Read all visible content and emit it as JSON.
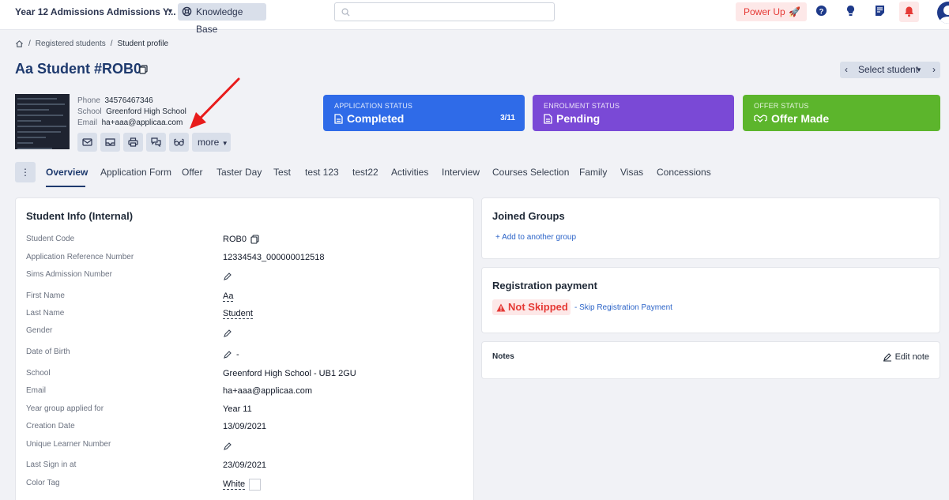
{
  "topbar": {
    "title": "Year 12 Admissions Admissions Y...",
    "knowledge_base": "Knowledge Base",
    "power_up": "Power Up",
    "icons": [
      "help-icon",
      "lightbulb-icon",
      "notes-icon",
      "bell-icon",
      "user-avatar"
    ]
  },
  "breadcrumb": {
    "items": [
      "Registered students",
      "Student profile"
    ]
  },
  "profile": {
    "title": "Aa Student #ROB0",
    "select_student": "Select student",
    "phone_label": "Phone",
    "phone": "34576467346",
    "school_label": "School",
    "school": "Greenford High School",
    "email_label": "Email",
    "email": "ha+aaa@applicaa.com",
    "more_label": "more",
    "action_icons": [
      "mail-icon",
      "inbox-icon",
      "print-icon",
      "chat-icon",
      "glasses-icon"
    ]
  },
  "status_cards": [
    {
      "label": "APPLICATION STATUS",
      "value": "Completed",
      "count": "3/11",
      "color": "#2f6be8"
    },
    {
      "label": "ENROLMENT STATUS",
      "value": "Pending",
      "count": "",
      "color": "#7a49d6"
    },
    {
      "label": "OFFER STATUS",
      "value": "Offer Made",
      "count": "",
      "color": "#5cb52c"
    }
  ],
  "tabs": [
    "Overview",
    "Application Form",
    "Offer",
    "Taster Day",
    "Test",
    "test 123",
    "test22",
    "Activities",
    "Interview",
    "Courses Selection",
    "Family",
    "Visas",
    "Concessions"
  ],
  "student_info": {
    "title": "Student Info (Internal)",
    "rows": [
      {
        "label": "Student Code",
        "value": "ROB0"
      },
      {
        "label": "Application Reference Number",
        "value": "12334543_000000012518"
      },
      {
        "label": "Sims Admission Number",
        "value": ""
      },
      {
        "label": "First Name",
        "value": "Aa"
      },
      {
        "label": "Last Name",
        "value": "Student"
      },
      {
        "label": "Gender",
        "value": ""
      },
      {
        "label": "Date of Birth",
        "value": "-"
      },
      {
        "label": "School",
        "value": "Greenford High School - UB1 2GU"
      },
      {
        "label": "Email",
        "value": "ha+aaa@applicaa.com"
      },
      {
        "label": "Year group applied for",
        "value": "Year 11"
      },
      {
        "label": "Creation Date",
        "value": "13/09/2021"
      },
      {
        "label": "Unique Learner Number",
        "value": ""
      },
      {
        "label": "Last Sign in at",
        "value": "23/09/2021"
      },
      {
        "label": "Color Tag",
        "value": "White"
      }
    ]
  },
  "joined_groups": {
    "title": "Joined Groups",
    "add_link": "Add to another group"
  },
  "registration_payment": {
    "title": "Registration payment",
    "status": "Not Skipped",
    "skip_link": "- Skip Registration Payment"
  },
  "notes": {
    "title": "Notes",
    "edit_label": "Edit note"
  }
}
